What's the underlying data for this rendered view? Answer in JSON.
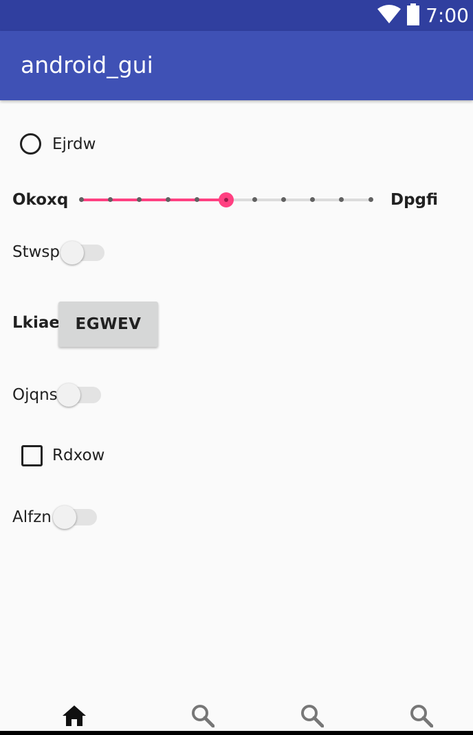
{
  "status_bar": {
    "time": "7:00",
    "icons": [
      "wifi-icon",
      "battery-icon"
    ]
  },
  "app_bar": {
    "title": "android_gui"
  },
  "radio": {
    "label": "Ejrdw",
    "checked": false
  },
  "slider": {
    "start_label": "Okoxq",
    "end_label": "Dpgfi",
    "value": 5,
    "steps": 10,
    "accent": "#ff4081"
  },
  "switches": [
    {
      "label": "Stwsp",
      "on": false
    },
    {
      "label": "Ojqns",
      "on": false
    },
    {
      "label": "Alfzn",
      "on": false
    }
  ],
  "button_row": {
    "label": "Lkiae",
    "button_text": "EGWEV"
  },
  "checkbox": {
    "label": "Rdxow",
    "checked": false
  },
  "bottom_nav": {
    "items": [
      {
        "icon": "home-icon",
        "active": true
      },
      {
        "icon": "search-icon",
        "active": false
      },
      {
        "icon": "search-icon",
        "active": false
      },
      {
        "icon": "search-icon",
        "active": false
      }
    ]
  },
  "colors": {
    "primary": "#3f51b5",
    "primary_dark": "#303f9f",
    "accent": "#ff4081"
  }
}
